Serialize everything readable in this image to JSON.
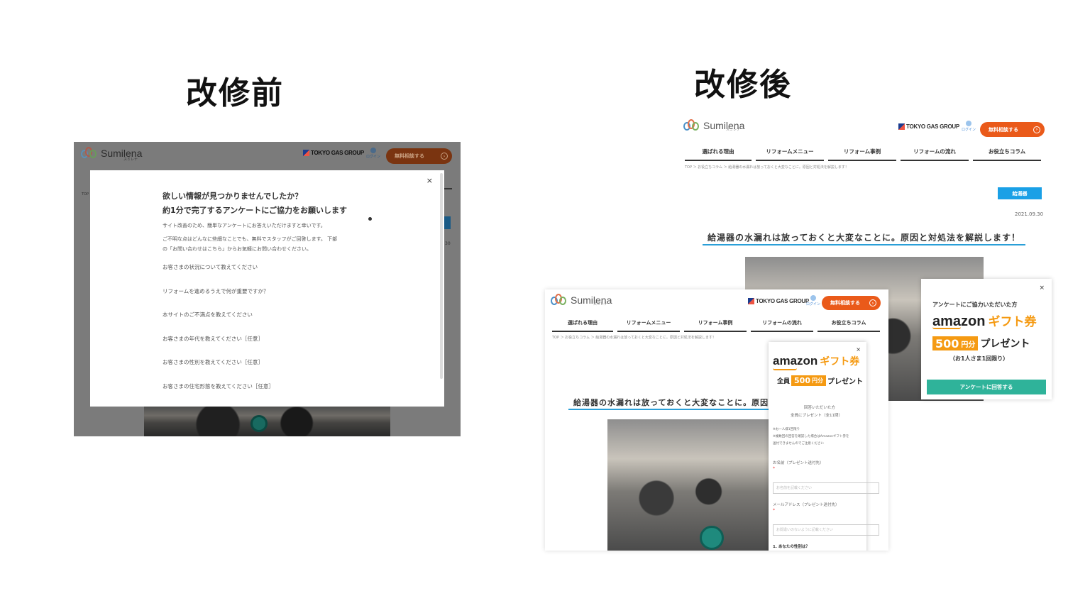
{
  "headings": {
    "before": "改修前",
    "after": "改修後"
  },
  "site": {
    "logo_name": "Sumilena",
    "logo_sub": "スミレナ",
    "group_name": "TOKYO GAS GROUP",
    "login": "ログイン",
    "cta": "無料相談する",
    "cta_icon": "›"
  },
  "before_modal": {
    "close": "×",
    "title_line1": "欲しい情報が見つかりませんでしたか？",
    "title_line2": "約1分で完了するアンケートにご協力をお願いします",
    "intro": "サイト改善のため、簡単なアンケートにお答えいただけますと幸いです。",
    "note_line1": "ご不明な点はどんなに些細なことでも、無料でスタッフがご回答します。 下部",
    "note_line2": "の「お問い合わせはこちら」からお気軽にお問い合わせください。",
    "questions": [
      "お客さまの状況について教えてください",
      "リフォームを進めるうえで何が重要ですか？",
      "本サイトのご不満点を教えてください",
      "お客さまの年代を教えてください［任意］",
      "お客さまの性別を教えてください［任意］",
      "お客さまの住宅形態を教えてください［任意］"
    ],
    "bg_top": "TOP",
    "bg_date": "30"
  },
  "nav": [
    "選ばれる理由",
    "リフォームメニュー",
    "リフォーム事例",
    "リフォームの流れ",
    "お役立ちコラム"
  ],
  "article": {
    "breadcrumb": "TOP ＞ お役立ちコラム ＞ 給湯器の水漏れは放っておくと大変なことに。原因と対処法を解説します！",
    "category": "給湯器",
    "date": "2021.09.30",
    "title": "給湯器の水漏れは放っておくと大変なことに。原因と対処法を解説します！",
    "title_short": "給湯器の水漏れは放っておくと大変なことに。原因"
  },
  "popup_right": {
    "close": "×",
    "lead": "アンケートにご協力いただいた方",
    "amazon": "amazon",
    "gift": "ギフト券",
    "price": "500",
    "yen": "円分",
    "present": "プレゼント",
    "limit": "（お1人さま1回限り）",
    "button": "アンケートに回答する"
  },
  "mobile_form": {
    "close": "×",
    "amazon": "amazon",
    "gift": "ギフト券",
    "all": "全員",
    "price": "500",
    "yen": "円分",
    "present": "プレゼント",
    "answered_line1": "回答いただいた方",
    "answered_line2": "全員にプレゼント（全11問）",
    "note1": "※お一人様1回限り",
    "note2": "※複数回の回答を確認した場合はAmazonギフト券を",
    "note3": "送付できませんのでご注意ください",
    "name_label": "お名前（プレゼント送付先）",
    "name_placeholder": "お名前を記載ください",
    "email_label": "メールアドレス（プレゼント送付先）",
    "email_placeholder": "お間違いのないように記載ください",
    "required": "*",
    "q1": "1. あなたの性別は？"
  },
  "colors": {
    "accent_orange": "#ea5a1a",
    "blue": "#1aa0e6",
    "teal": "#2fb39a",
    "amazon_orange": "#f59a12"
  }
}
